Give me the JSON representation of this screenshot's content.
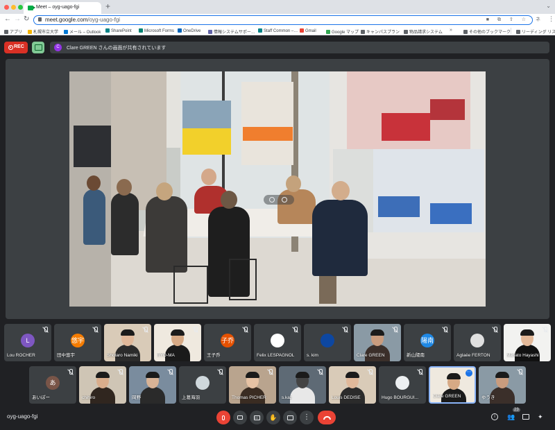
{
  "browser": {
    "tab_title": "Meet – oyg-uago-fgi",
    "tab_close": "×",
    "new_tab": "+",
    "tab_menu": "⌄",
    "url_host": "meet.google.com",
    "url_path": "/oyg-uago-fgi",
    "omnibox_icons": "■ ⧉ ⇧ ☆",
    "profile": "ネ",
    "menu": "⋮",
    "nav_back": "←",
    "nav_forward": "→",
    "nav_reload": "↻"
  },
  "bookmarks": [
    {
      "label": "アプリ",
      "color": "#5f6368"
    },
    {
      "label": "札幌市立大学",
      "color": "#f4b400"
    },
    {
      "label": "メール – Outlook",
      "color": "#0078d4"
    },
    {
      "label": "SharePoint",
      "color": "#038387"
    },
    {
      "label": "Microsoft Forms",
      "color": "#008272"
    },
    {
      "label": "OneDrive",
      "color": "#0364b8"
    },
    {
      "label": "情報システムサポー…",
      "color": "#6264a7"
    },
    {
      "label": "Staff Common –…",
      "color": "#038387"
    },
    {
      "label": "Gmail",
      "color": "#ea4335"
    },
    {
      "label": "Google マップ",
      "color": "#34a853"
    },
    {
      "label": "キャンパスプラン",
      "color": "#5f6368"
    },
    {
      "label": "物品請求システム",
      "color": "#5f6368"
    },
    {
      "label": "その他のブックマーク",
      "color": "#5f6368"
    },
    {
      "label": "リーディング リスト",
      "color": "#5f6368"
    }
  ],
  "bookmarks_more": "»",
  "meet": {
    "rec_label": "REC",
    "share_avatar_letter": "C",
    "share_banner": "Clare GREEN さんの画面が共有されています",
    "meeting_code": "oyg-uago-fgi",
    "participant_count": "23",
    "more_options": "⋮",
    "hand_icon": "✋",
    "cc_label": "CC",
    "info_icon": "i",
    "people_icon": "👥",
    "activities_icon": "✦"
  },
  "participants_row1": [
    {
      "name": "Lou ROCHER",
      "avatar": "L",
      "color": "#7e57c2",
      "type": "avatar"
    },
    {
      "name": "田中悠宇",
      "avatar": "悠宇",
      "color": "#f57c00",
      "type": "avatar"
    },
    {
      "name": "Shotaro Namiki",
      "type": "photo"
    },
    {
      "name": "RYO-MA",
      "type": "photo"
    },
    {
      "name": "王子乔",
      "avatar": "子乔",
      "color": "#e65100",
      "type": "avatar"
    },
    {
      "name": "Felix LESPAGNOL",
      "avatar": "",
      "color": "#ffffff",
      "type": "avatar"
    },
    {
      "name": "s. kim",
      "avatar": "",
      "color": "#0d47a1",
      "type": "avatar"
    },
    {
      "name": "Clare GREEN",
      "type": "photo"
    },
    {
      "name": "新山陽南",
      "avatar": "陽南",
      "color": "#1e88e5",
      "type": "avatar"
    },
    {
      "name": "Aglaée FERTON",
      "avatar": "",
      "color": "#e0e0e0",
      "type": "avatar"
    },
    {
      "name": "Masato Hayashi",
      "type": "photo"
    }
  ],
  "participants_row2": [
    {
      "name": "あいぽー",
      "avatar": "あ",
      "color": "#795548",
      "type": "avatar"
    },
    {
      "name": "chihiro",
      "type": "photo"
    },
    {
      "name": "岡野",
      "type": "photo"
    },
    {
      "name": "上葛海羽",
      "avatar": "",
      "color": "#cfd8dc",
      "type": "avatar"
    },
    {
      "name": "Thomas PICHER",
      "type": "photo"
    },
    {
      "name": "s.kaz",
      "type": "photo"
    },
    {
      "name": "Louis DEDISE",
      "type": "photo"
    },
    {
      "name": "Hugo BOURGUI...",
      "avatar": "",
      "color": "#eceff1",
      "type": "avatar"
    },
    {
      "name": "Clare GREEN",
      "type": "photo",
      "active": true
    },
    {
      "name": "ゆうき",
      "type": "photo"
    }
  ]
}
